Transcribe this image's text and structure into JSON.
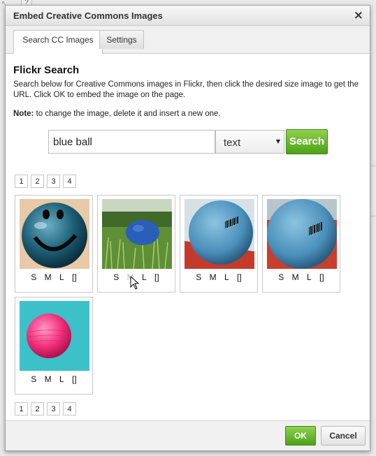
{
  "dialog": {
    "title": "Embed Creative Commons Images",
    "close_icon": "×"
  },
  "tabs": [
    {
      "label": "Search CC Images",
      "active": true
    },
    {
      "label": "Settings",
      "active": false
    }
  ],
  "main": {
    "heading": "Flickr Search",
    "description": "Search below for Creative Commons images in Flickr, then click the desired size image to get the URL. Click OK to embed the image on the page.",
    "note_label": "Note:",
    "note_text": " to change the image, delete it and insert a new one."
  },
  "search": {
    "query": "blue ball",
    "type_selected": "text",
    "button_label": "Search"
  },
  "pagination": [
    "1",
    "2",
    "3",
    "4"
  ],
  "results": [
    {
      "name": "blue glitter smiley ball",
      "sizes": [
        "S",
        "M",
        "L",
        "[]"
      ]
    },
    {
      "name": "blue ball on grass",
      "sizes": [
        "S",
        "M",
        "L",
        "[]"
      ]
    },
    {
      "name": "light blue ball on red",
      "sizes": [
        "S",
        "M",
        "L",
        "[]"
      ]
    },
    {
      "name": "light blue ball closeup",
      "sizes": [
        "S",
        "M",
        "L",
        "[]"
      ]
    },
    {
      "name": "pink ball on turquoise",
      "sizes": [
        "S",
        "M",
        "L",
        "[]"
      ]
    }
  ],
  "footer": {
    "ok_label": "OK",
    "cancel_label": "Cancel"
  },
  "colors": {
    "accent_green": "#5cae22",
    "title_bg": "#e6e6e6"
  }
}
